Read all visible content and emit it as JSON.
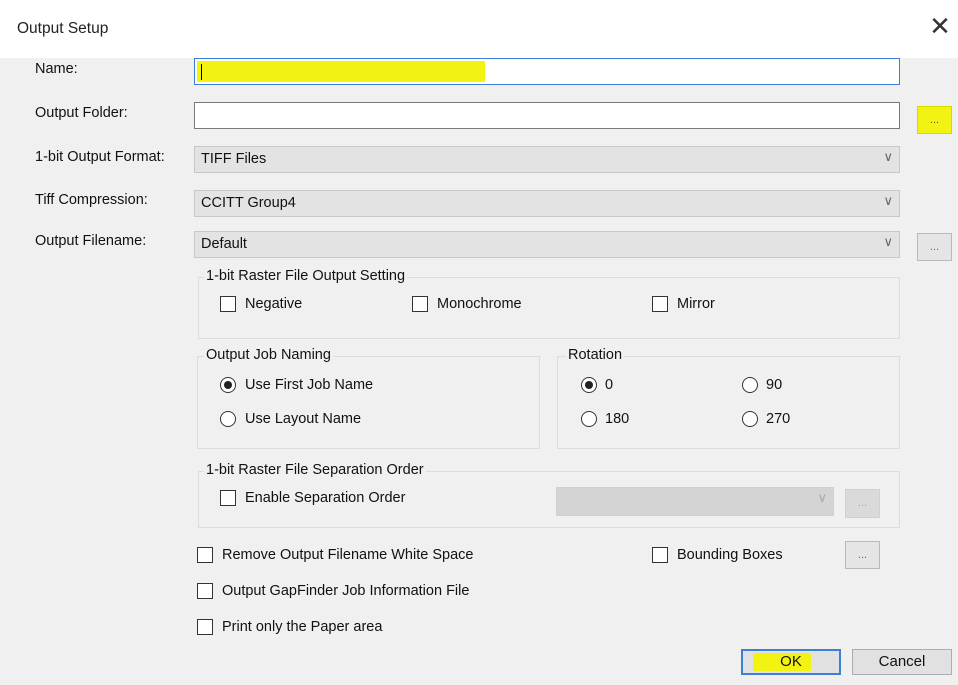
{
  "window": {
    "title": "Output Setup",
    "close_label": "✕"
  },
  "labels": {
    "name": "Name:",
    "output_folder": "Output Folder:",
    "bit_output_format": "1-bit Output Format:",
    "tiff_compression": "Tiff Compression:",
    "output_filename": "Output Filename:"
  },
  "fields": {
    "name_value": "",
    "output_folder_value": "",
    "bit_output_format_value": "TIFF Files",
    "tiff_compression_value": "CCITT Group4",
    "output_filename_value": "Default",
    "separation_order_value": ""
  },
  "ellipsis": "...",
  "raster_output": {
    "title": "1-bit Raster File Output Setting",
    "negative": "Negative",
    "monochrome": "Monochrome",
    "mirror": "Mirror"
  },
  "job_naming": {
    "title": "Output Job Naming",
    "first_job": "Use First Job Name",
    "layout_name": "Use Layout Name",
    "selected": "Use First Job Name"
  },
  "rotation": {
    "title": "Rotation",
    "options": [
      "0",
      "90",
      "180",
      "270"
    ],
    "selected": "0"
  },
  "separation": {
    "title": "1-bit Raster File Separation Order",
    "enable": "Enable Separation Order"
  },
  "options": {
    "remove_ws": "Remove Output Filename White Space",
    "bounding_boxes": "Bounding Boxes",
    "gapfinder": "Output GapFinder Job Information File",
    "paper_area": "Print only the Paper area"
  },
  "buttons": {
    "ok": "OK",
    "cancel": "Cancel"
  },
  "colors": {
    "highlight": "#f3f313",
    "focus_border": "#3c7fd6",
    "background": "#f0f0f0"
  }
}
